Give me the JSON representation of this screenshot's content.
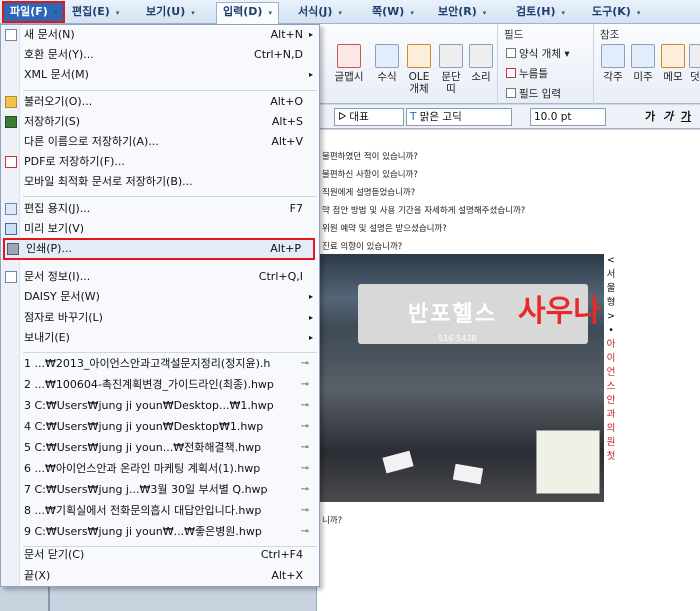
{
  "menubar": {
    "items": [
      {
        "label": "파일(F)",
        "arrow": "▾"
      },
      {
        "label": "편집(E)",
        "arrow": "▾"
      },
      {
        "label": "보기(U)",
        "arrow": "▾"
      },
      {
        "label": "입력(D)",
        "arrow": "▾"
      },
      {
        "label": "서식(J)",
        "arrow": "▾"
      },
      {
        "label": "쪽(W)",
        "arrow": "▾"
      },
      {
        "label": "보안(R)",
        "arrow": "▾"
      },
      {
        "label": "검토(H)",
        "arrow": "▾"
      },
      {
        "label": "도구(K)",
        "arrow": "▾"
      }
    ]
  },
  "ribbon": {
    "buttons": [
      {
        "label": "글맵시",
        "icon": "text-art-icon"
      },
      {
        "label": "수식",
        "icon": "formula-icon"
      },
      {
        "label": "OLE\n개체",
        "icon": "ole-icon"
      },
      {
        "label": "문단\n띠",
        "icon": "paragraph-band-icon"
      },
      {
        "label": "소리",
        "icon": "sound-icon"
      }
    ],
    "field_group": {
      "title": "필드",
      "items": [
        "양식 개체 ▾",
        "누름틀",
        "필드 입력"
      ]
    },
    "ref_group": {
      "title": "참조",
      "buttons": [
        "각주",
        "미주",
        "메모",
        "덧"
      ]
    }
  },
  "formatbar": {
    "style": "대표",
    "font": "맑은 고딕",
    "size": "10.0",
    "unit": "pt",
    "bold": "가",
    "italic": "가",
    "underline": "가"
  },
  "document": {
    "lines": [
      "불편하였던 적이 있습니까?",
      "불편하신 사항이 있습니까?",
      "직원에게 설명듣었습니까?",
      "약 점안 방법 및 사용 기간을 자세하게 설명해주셨습니까?",
      "위원 예약 및 설명은 받으셨습니까?",
      "진료 의향이 있습니까?"
    ],
    "photo": {
      "sign_text": "반포헬스",
      "sign_text_red": "사우나",
      "sign_phone": "516-5438"
    },
    "side_chars": [
      "<",
      "서",
      "울",
      "형",
      ">",
      "•",
      "아",
      "이",
      "언",
      "스",
      "안",
      "과",
      "의",
      "원",
      "첫"
    ],
    "bottom_line": "니까?"
  },
  "file_menu": {
    "items": [
      {
        "label": "새 문서(N)",
        "shortcut": "Alt+N",
        "submenu": true,
        "icon": "new-doc-icon"
      },
      {
        "label": "호환 문서(Y)...",
        "shortcut": "Ctrl+N,D",
        "icon": ""
      },
      {
        "label": "XML 문서(M)",
        "submenu": true,
        "icon": ""
      },
      {
        "label": "불러오기(O)...",
        "shortcut": "Alt+O",
        "icon": "open-folder-icon"
      },
      {
        "label": "저장하기(S)",
        "shortcut": "Alt+S",
        "icon": "save-icon"
      },
      {
        "label": "다른 이름으로 저장하기(A)...",
        "shortcut": "Alt+V",
        "icon": ""
      },
      {
        "label": "PDF로 저장하기(F)...",
        "icon": "pdf-icon"
      },
      {
        "label": "모바일 최적화 문서로 저장하기(B)...",
        "icon": ""
      },
      {
        "label": "편집 용지(J)...",
        "shortcut": "F7",
        "icon": "page-setup-icon"
      },
      {
        "label": "미리 보기(V)",
        "icon": "print-preview-icon"
      },
      {
        "label": "인쇄(P)...",
        "shortcut": "Alt+P",
        "icon": "printer-icon",
        "highlighted": true
      },
      {
        "label": "문서 정보(I)...",
        "shortcut": "Ctrl+Q,I",
        "icon": "doc-info-icon"
      },
      {
        "label": "DAISY 문서(W)",
        "submenu": true,
        "icon": ""
      },
      {
        "label": "점자로 바꾸기(L)",
        "submenu": true,
        "icon": ""
      },
      {
        "label": "보내기(E)",
        "submenu": true,
        "icon": ""
      }
    ],
    "recent": [
      "1 ...₩2013_아이언스안과고객설문지정리(정지윤).h",
      "2 ...₩100604-촉진계획변경_가이드라인(최종).hwp",
      "3 C:₩Users₩jung ji youn₩Desktop...₩1.hwp",
      "4 C:₩Users₩jung ji youn₩Desktop₩1.hwp",
      "5 C:₩Users₩jung ji youn...₩전화해결책.hwp",
      "6 ...₩아이언스안과 온라인 마케팅 계획서(1).hwp",
      "7 C:₩Users₩jung j...₩3월 30일 부서별 Q.hwp",
      "8 ...₩기획실에서 전화문의흡시 대답안입니다.hwp",
      "9 C:₩Users₩jung ji youn₩...₩좋은병원.hwp"
    ],
    "pin_glyph": "⊸",
    "footer": [
      {
        "label": "문서 닫기(C)",
        "shortcut": "Ctrl+F4"
      },
      {
        "label": "끝(X)",
        "shortcut": "Alt+X"
      }
    ]
  }
}
